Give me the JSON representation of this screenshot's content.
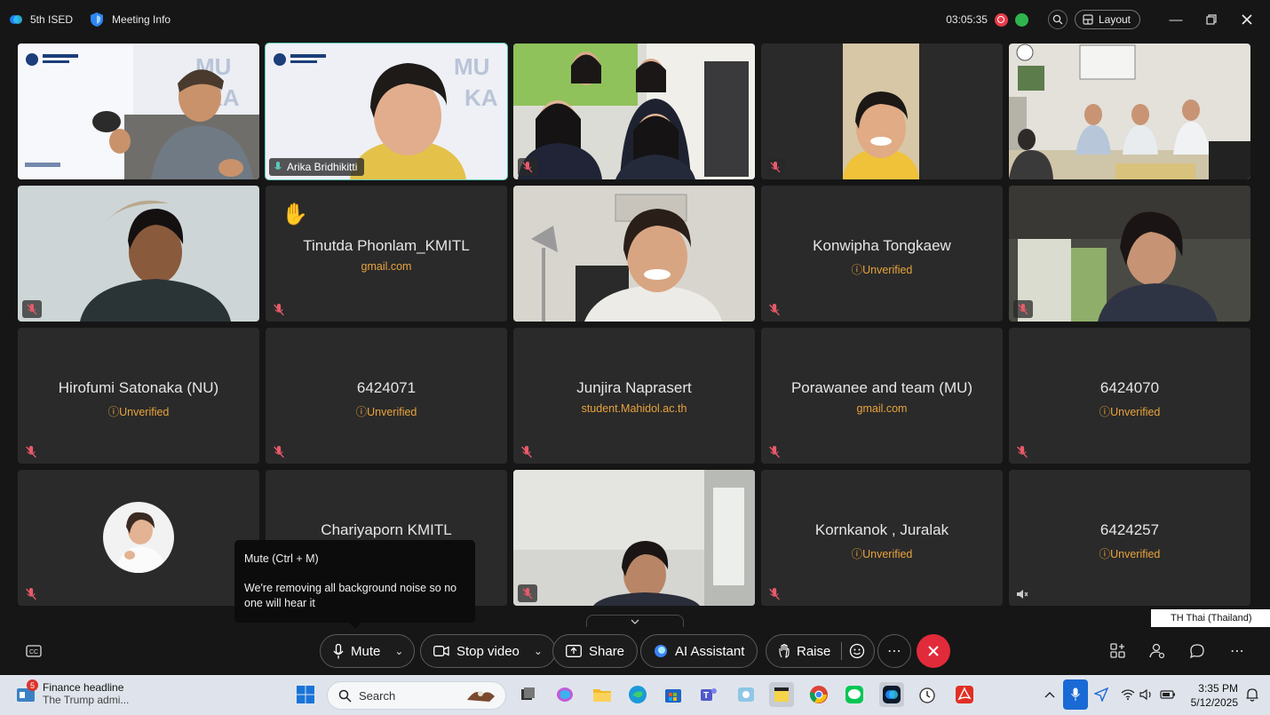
{
  "titlebar": {
    "app_name": "5th ISED",
    "meeting_info": "Meeting Info",
    "timer": "03:05:35",
    "layout_label": "Layout"
  },
  "tiles": [
    {
      "kind": "video",
      "name": "",
      "sub": "",
      "scene": "man-laughing",
      "muted": false
    },
    {
      "kind": "video",
      "name": "Arika Bridhikitti",
      "sub": "",
      "scene": "woman-speaking",
      "muted": false,
      "active": true
    },
    {
      "kind": "video",
      "name": "",
      "sub": "",
      "scene": "group-students",
      "muted": true
    },
    {
      "kind": "video",
      "name": "",
      "sub": "",
      "scene": "man-smiling",
      "muted": true
    },
    {
      "kind": "video",
      "name": "",
      "sub": "",
      "scene": "office-group",
      "muted": false
    },
    {
      "kind": "video",
      "name": "",
      "sub": "",
      "scene": "young-man",
      "muted": true
    },
    {
      "kind": "name",
      "name": "Tinutda Phonlam_KMITL",
      "sub": "gmail.com",
      "hand": true,
      "muted": true
    },
    {
      "kind": "video",
      "name": "",
      "sub": "",
      "scene": "woman-smiling",
      "muted": false
    },
    {
      "kind": "name",
      "name": "Konwipha Tongkaew",
      "sub": "Unverified",
      "unverified": true,
      "muted": true
    },
    {
      "kind": "video",
      "name": "",
      "sub": "",
      "scene": "man-window",
      "muted": true
    },
    {
      "kind": "name",
      "name": "Hirofumi Satonaka (NU)",
      "sub": "Unverified",
      "unverified": true,
      "muted": true
    },
    {
      "kind": "name",
      "name": "6424071",
      "sub": "Unverified",
      "unverified": true,
      "muted": true
    },
    {
      "kind": "name",
      "name": "Junjira Naprasert",
      "sub": "student.Mahidol.ac.th",
      "muted": true
    },
    {
      "kind": "name",
      "name": "Porawanee and team (MU)",
      "sub": "gmail.com",
      "muted": true
    },
    {
      "kind": "name",
      "name": "6424070",
      "sub": "Unverified",
      "unverified": true,
      "muted": true
    },
    {
      "kind": "avatar",
      "name": "",
      "sub": "",
      "muted": true
    },
    {
      "kind": "name",
      "name": "Chariyaporn KMITL",
      "sub": "",
      "muted": true
    },
    {
      "kind": "video",
      "name": "",
      "sub": "",
      "scene": "man-room",
      "muted": true
    },
    {
      "kind": "name",
      "name": "Kornkanok , Juralak",
      "sub": "Unverified",
      "unverified": true,
      "muted": true
    },
    {
      "kind": "name",
      "name": "6424257",
      "sub": "Unverified",
      "unverified": true,
      "speaker": true
    }
  ],
  "tooltip": {
    "title": "Mute  (Ctrl + M)",
    "body": "We're removing all background noise so no one will hear it"
  },
  "language": "TH Thai (Thailand)",
  "controls": {
    "mute": "Mute",
    "stop_video": "Stop video",
    "share": "Share",
    "ai_assistant": "AI Assistant",
    "raise": "Raise"
  },
  "taskbar": {
    "news_badge": "5",
    "news_title": "Finance headline",
    "news_sub": "The Trump admi...",
    "search_placeholder": "Search",
    "time": "3:35 PM",
    "date": "5/12/2025"
  },
  "colors": {
    "accent_unverified": "#e8a33c",
    "end_call": "#e22b3a",
    "active_speaker": "#5cc9b8"
  }
}
